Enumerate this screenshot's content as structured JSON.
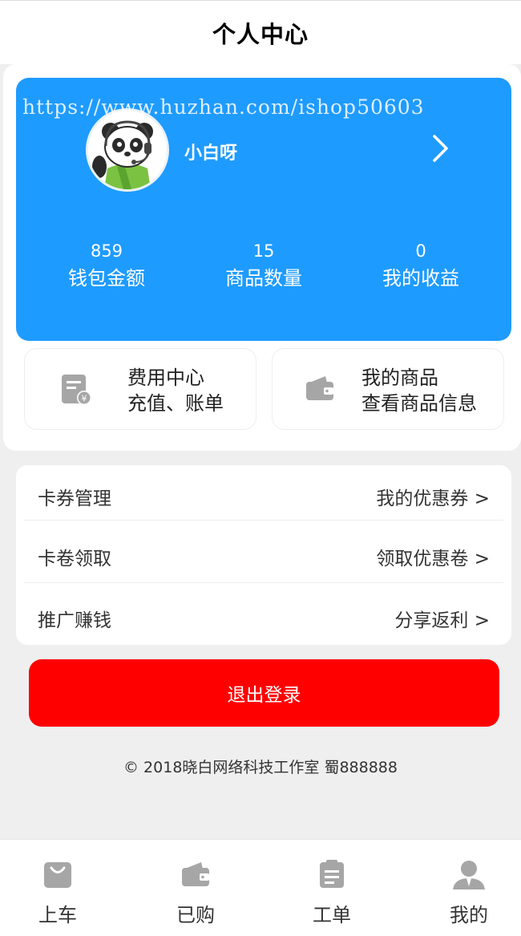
{
  "header": {
    "title": "个人中心"
  },
  "profile": {
    "watermark": "https://www.huzhan.com/ishop50603",
    "username": "小白呀",
    "avatar_icon": "panda-avatar-icon",
    "arrow_icon": "chevron-right-icon",
    "card_color": "#1e9bff",
    "stats": [
      {
        "value": "859",
        "label": "钱包金额"
      },
      {
        "value": "15",
        "label": "商品数量"
      },
      {
        "value": "0",
        "label": "我的收益"
      }
    ]
  },
  "quick": [
    {
      "icon": "bill-icon",
      "line1": "费用中心",
      "line2": "充值、账单"
    },
    {
      "icon": "wallet-icon",
      "line1": "我的商品",
      "line2": "查看商品信息"
    }
  ],
  "menu": [
    {
      "left": "卡券管理",
      "right": "我的优惠券 >"
    },
    {
      "left": "卡卷领取",
      "right": "领取优惠卷 >"
    },
    {
      "left": "推广赚钱",
      "right": "分享返利 >"
    }
  ],
  "logout": {
    "label": "退出登录",
    "color": "#ff0000"
  },
  "footer": {
    "text": "© 2018晓白网络科技工作室 蜀888888"
  },
  "tabbar": [
    {
      "label": "上车",
      "icon": "shopping-bag-icon"
    },
    {
      "label": "已购",
      "icon": "wallet-icon"
    },
    {
      "label": "工单",
      "icon": "clipboard-icon"
    },
    {
      "label": "我的",
      "icon": "user-icon"
    }
  ]
}
